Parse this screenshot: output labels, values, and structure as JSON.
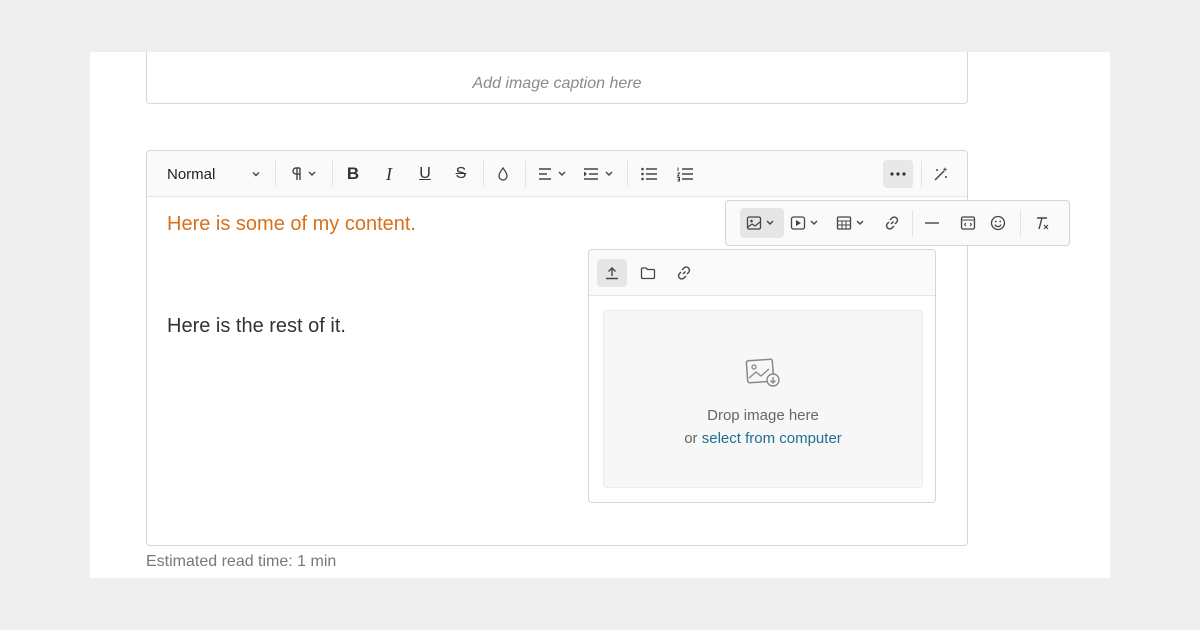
{
  "caption": {
    "placeholder": "Add image caption here"
  },
  "toolbar": {
    "style_select": "Normal",
    "icons": [
      "paragraph-icon",
      "bold-icon",
      "italic-icon",
      "underline-icon",
      "strikethrough-icon",
      "color-drop-icon",
      "align-icon",
      "indent-icon",
      "bullet-list-icon",
      "numbered-list-icon",
      "more-icon",
      "magic-wand-icon"
    ]
  },
  "content": {
    "line1": "Here is some of my content.",
    "line2": "Here is the rest of it.",
    "line1_color": "#d9701a"
  },
  "insert_toolbar": {
    "icons": [
      "image-icon",
      "video-icon",
      "table-icon",
      "link-icon",
      "horizontal-rule-icon",
      "embed-icon",
      "emoji-icon",
      "clear-format-icon"
    ]
  },
  "image_panel": {
    "tabs": [
      "upload-icon",
      "folder-icon",
      "link-icon"
    ],
    "drop_title": "Drop image here",
    "drop_or": "or",
    "drop_link": "select from computer",
    "link_color": "#1f6f93"
  },
  "footer": {
    "read_time": "Estimated read time: 1 min"
  }
}
